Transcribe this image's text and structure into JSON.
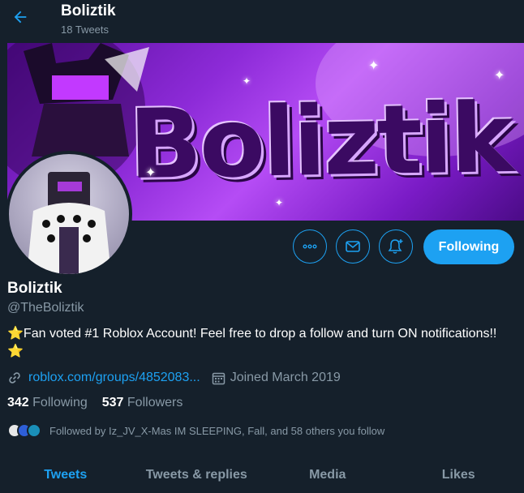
{
  "header": {
    "title": "Boliztik",
    "tweet_count": "18 Tweets"
  },
  "banner": {
    "text": "Boliztik"
  },
  "profile": {
    "name": "Boliztik",
    "handle": "@TheBoliztik",
    "bio": "⭐Fan voted #1 Roblox Account! Feel free to drop a follow and turn ON notifications!!⭐",
    "link": "roblox.com/groups/4852083...",
    "joined": "Joined March 2019"
  },
  "actions": {
    "following_label": "Following"
  },
  "counts": {
    "following_num": "342",
    "following_label": "Following",
    "followers_num": "537",
    "followers_label": "Followers"
  },
  "followed_by": "Followed by Iz_JV_X-Mas IM SLEEPING, Fall, and 58 others you follow",
  "tabs": [
    {
      "label": "Tweets"
    },
    {
      "label": "Tweets & replies"
    },
    {
      "label": "Media"
    },
    {
      "label": "Likes"
    }
  ],
  "colors": {
    "background": "#15202b",
    "accent": "#1da1f2",
    "muted": "#8899a6"
  }
}
